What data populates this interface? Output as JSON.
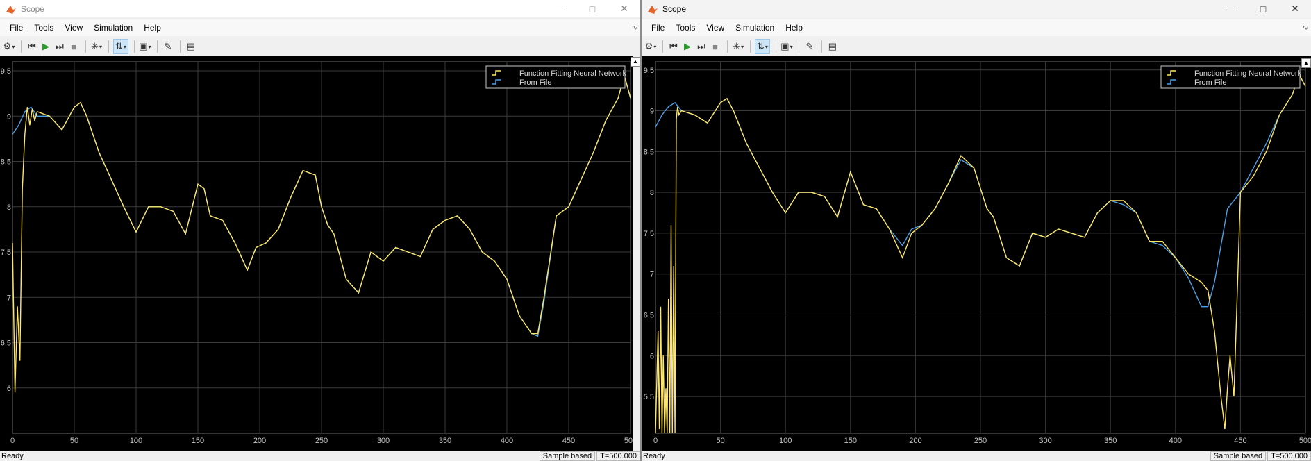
{
  "windows": [
    {
      "id": "left",
      "title": "Scope",
      "menu": [
        "File",
        "Tools",
        "View",
        "Simulation",
        "Help"
      ],
      "toolbar_icons": [
        "settings-icon",
        "step-back-icon",
        "run-icon",
        "step-forward-icon",
        "stop-icon",
        "highlight-icon",
        "zoom-icon",
        "scale-icon",
        "axes-properties-icon",
        "style-icon"
      ],
      "status": {
        "text": "Ready",
        "mode": "Sample based",
        "time": "T=500.000"
      },
      "chart_data": {
        "type": "line",
        "xlim": [
          0,
          500
        ],
        "ylim": [
          5.5,
          9.6
        ],
        "xticks": [
          0,
          50,
          100,
          150,
          200,
          250,
          300,
          350,
          400,
          450,
          500
        ],
        "yticks": [
          6,
          6.5,
          7,
          7.5,
          8,
          8.5,
          9,
          9.5
        ],
        "grid": true,
        "legend_position": "top-right",
        "series": [
          {
            "name": "Function Fitting Neural Network",
            "color": "#FFE666",
            "x": [
              0,
              2,
              4,
              6,
              8,
              10,
              12,
              14,
              16,
              18,
              20,
              30,
              40,
              50,
              55,
              60,
              70,
              80,
              90,
              100,
              110,
              120,
              130,
              140,
              150,
              155,
              160,
              170,
              180,
              190,
              197,
              205,
              215,
              225,
              235,
              245,
              250,
              255,
              260,
              270,
              280,
              290,
              300,
              310,
              320,
              330,
              340,
              350,
              360,
              370,
              380,
              390,
              400,
              410,
              420,
              425,
              430,
              440,
              450,
              460,
              470,
              480,
              490,
              495,
              500
            ],
            "y": [
              7.6,
              5.95,
              6.9,
              6.3,
              8.2,
              8.8,
              9.1,
              8.9,
              9.08,
              8.95,
              9.05,
              9.0,
              8.85,
              9.1,
              9.15,
              9.0,
              8.6,
              8.3,
              8.0,
              7.72,
              8.0,
              8.0,
              7.95,
              7.7,
              8.25,
              8.2,
              7.9,
              7.85,
              7.6,
              7.3,
              7.55,
              7.6,
              7.75,
              8.1,
              8.4,
              8.35,
              8.0,
              7.8,
              7.7,
              7.2,
              7.05,
              7.5,
              7.4,
              7.55,
              7.5,
              7.45,
              7.75,
              7.85,
              7.9,
              7.75,
              7.5,
              7.4,
              7.2,
              6.8,
              6.6,
              6.6,
              7.0,
              7.9,
              8.0,
              8.3,
              8.6,
              8.95,
              9.2,
              9.45,
              9.2
            ]
          },
          {
            "name": "From File",
            "color": "#4D9FE6",
            "x": [
              0,
              5,
              10,
              15,
              20,
              30,
              40,
              50,
              55,
              60,
              70,
              80,
              90,
              100,
              110,
              120,
              130,
              140,
              150,
              155,
              160,
              170,
              180,
              190,
              197,
              205,
              215,
              225,
              235,
              245,
              250,
              255,
              260,
              270,
              280,
              290,
              300,
              310,
              320,
              330,
              340,
              350,
              360,
              370,
              380,
              390,
              400,
              410,
              420,
              425,
              430,
              440,
              450,
              460,
              470,
              480,
              490,
              495,
              500
            ],
            "y": [
              8.8,
              8.9,
              9.05,
              9.1,
              9.0,
              9.0,
              8.85,
              9.1,
              9.15,
              9.0,
              8.6,
              8.3,
              8.0,
              7.72,
              8.0,
              8.0,
              7.95,
              7.7,
              8.25,
              8.2,
              7.9,
              7.85,
              7.6,
              7.3,
              7.55,
              7.6,
              7.75,
              8.1,
              8.4,
              8.35,
              8.0,
              7.8,
              7.7,
              7.2,
              7.05,
              7.5,
              7.4,
              7.55,
              7.5,
              7.45,
              7.75,
              7.85,
              7.9,
              7.75,
              7.5,
              7.4,
              7.2,
              6.8,
              6.6,
              6.57,
              6.95,
              7.9,
              8.0,
              8.3,
              8.6,
              8.95,
              9.2,
              9.45,
              9.2
            ]
          }
        ]
      }
    },
    {
      "id": "right",
      "title": "Scope",
      "menu": [
        "File",
        "Tools",
        "View",
        "Simulation",
        "Help"
      ],
      "toolbar_icons": [
        "settings-icon",
        "step-back-icon",
        "run-icon",
        "step-forward-icon",
        "stop-icon",
        "highlight-icon",
        "zoom-icon",
        "scale-icon",
        "axes-properties-icon",
        "style-icon"
      ],
      "status": {
        "text": "Ready",
        "mode": "Sample based",
        "time": "T=500.000"
      },
      "chart_data": {
        "type": "line",
        "xlim": [
          0,
          500
        ],
        "ylim": [
          5.05,
          9.6
        ],
        "xticks": [
          0,
          50,
          100,
          150,
          200,
          250,
          300,
          350,
          400,
          450,
          500
        ],
        "yticks": [
          5.5,
          6,
          6.5,
          7,
          7.5,
          8,
          8.5,
          9,
          9.5
        ],
        "grid": true,
        "legend_position": "top-right",
        "series": [
          {
            "name": "Function Fitting Neural Network",
            "color": "#FFE666",
            "x": [
              0,
              2,
              3,
              4,
              5,
              6,
              7,
              8,
              9,
              10,
              11,
              12,
              13,
              14,
              15,
              16,
              17,
              18,
              20,
              30,
              40,
              50,
              55,
              60,
              70,
              80,
              90,
              100,
              110,
              120,
              130,
              140,
              150,
              160,
              170,
              180,
              190,
              197,
              205,
              215,
              225,
              235,
              245,
              250,
              255,
              260,
              270,
              280,
              290,
              300,
              310,
              320,
              330,
              340,
              350,
              360,
              370,
              380,
              390,
              400,
              410,
              420,
              425,
              430,
              435,
              438,
              440,
              442,
              445,
              448,
              450,
              460,
              470,
              480,
              490,
              495,
              500
            ],
            "y": [
              5.05,
              6.3,
              5.1,
              6.6,
              5.05,
              6.0,
              5.05,
              5.6,
              5.05,
              6.7,
              5.05,
              7.6,
              5.05,
              7.1,
              5.05,
              8.9,
              9.05,
              8.95,
              9.0,
              8.95,
              8.85,
              9.1,
              9.15,
              9.0,
              8.6,
              8.3,
              8.0,
              7.75,
              8.0,
              8.0,
              7.95,
              7.7,
              8.25,
              7.85,
              7.8,
              7.55,
              7.2,
              7.5,
              7.6,
              7.8,
              8.1,
              8.45,
              8.3,
              8.05,
              7.8,
              7.7,
              7.2,
              7.1,
              7.5,
              7.45,
              7.55,
              7.5,
              7.45,
              7.75,
              7.9,
              7.9,
              7.75,
              7.4,
              7.4,
              7.2,
              7.0,
              6.9,
              6.8,
              6.3,
              5.5,
              5.1,
              5.6,
              6.0,
              5.5,
              7.0,
              8.0,
              8.2,
              8.5,
              8.95,
              9.2,
              9.45,
              9.3
            ]
          },
          {
            "name": "From File",
            "color": "#4D9FE6",
            "x": [
              0,
              5,
              10,
              15,
              20,
              30,
              40,
              50,
              55,
              60,
              70,
              80,
              90,
              100,
              110,
              120,
              130,
              140,
              150,
              160,
              170,
              180,
              190,
              197,
              205,
              215,
              225,
              235,
              245,
              250,
              255,
              260,
              270,
              280,
              290,
              300,
              310,
              320,
              330,
              340,
              350,
              360,
              370,
              380,
              390,
              400,
              410,
              420,
              425,
              430,
              440,
              450,
              460,
              470,
              480,
              490,
              495,
              500
            ],
            "y": [
              8.8,
              8.95,
              9.05,
              9.1,
              9.0,
              8.95,
              8.85,
              9.1,
              9.15,
              9.0,
              8.6,
              8.3,
              8.0,
              7.75,
              8.0,
              8.0,
              7.95,
              7.7,
              8.25,
              7.85,
              7.8,
              7.55,
              7.35,
              7.55,
              7.6,
              7.8,
              8.1,
              8.4,
              8.3,
              8.05,
              7.8,
              7.7,
              7.2,
              7.1,
              7.5,
              7.45,
              7.55,
              7.5,
              7.45,
              7.75,
              7.9,
              7.85,
              7.75,
              7.4,
              7.35,
              7.2,
              6.95,
              6.6,
              6.6,
              6.9,
              7.8,
              8.0,
              8.3,
              8.6,
              8.95,
              9.2,
              9.45,
              9.3
            ]
          }
        ]
      }
    }
  ]
}
